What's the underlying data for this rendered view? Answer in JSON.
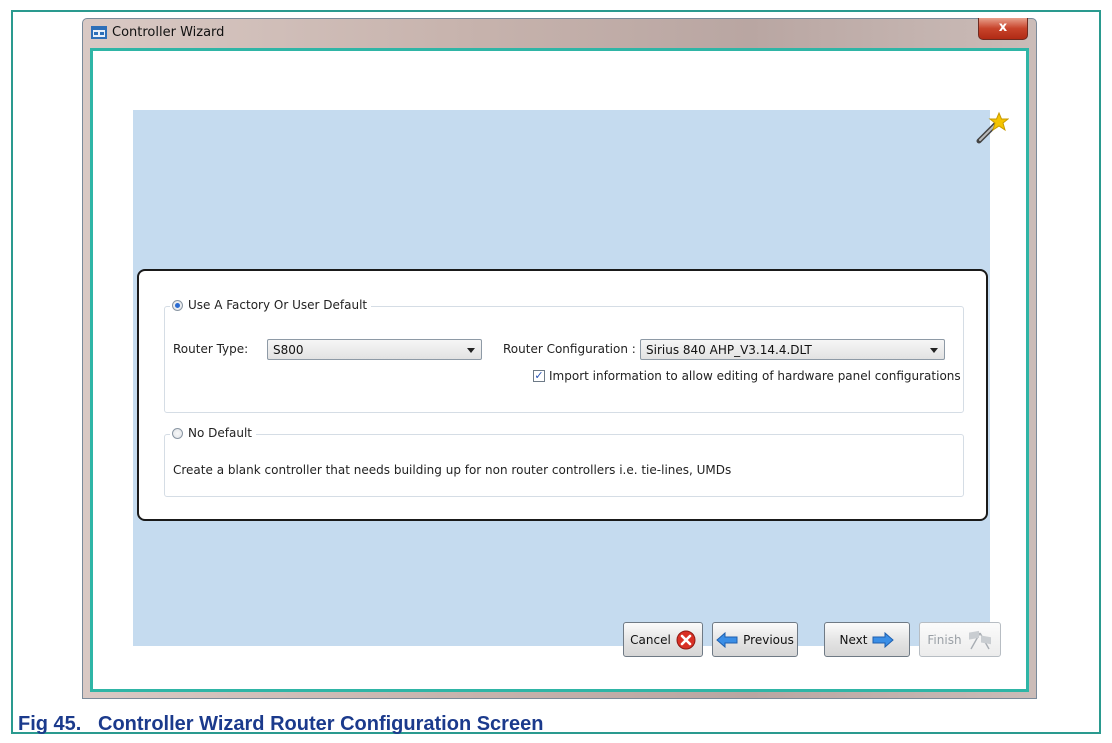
{
  "window": {
    "title": "Controller Wizard",
    "close_label": "x"
  },
  "option_default": {
    "label": "Use A Factory Or User Default",
    "selected": true,
    "router_type_label": "Router Type:",
    "router_type_value": "S800",
    "router_config_label": "Router Configuration :",
    "router_config_value": "Sirius 840 AHP_V3.14.4.DLT",
    "import_checkbox_label": "Import information to allow editing of hardware panel configurations",
    "import_checked": true
  },
  "option_no_default": {
    "label": "No Default",
    "selected": false,
    "description": "Create a blank controller that needs building up for non router controllers i.e. tie-lines, UMDs"
  },
  "buttons": {
    "cancel": "Cancel",
    "previous": "Previous",
    "next": "Next",
    "finish": "Finish"
  },
  "icons": {
    "title": "window-app-icon",
    "wand": "magic-wand-icon",
    "cancel": "cancel-x-icon",
    "previous": "arrow-left-icon",
    "next": "arrow-right-icon",
    "finish": "checkered-flags-icon"
  },
  "caption": "Fig 45.   Controller Wizard Router Configuration Screen",
  "colors": {
    "frame_teal": "#2fb5a6",
    "panel_blue": "#c5dbef",
    "caption_blue": "#1b3a8c"
  }
}
